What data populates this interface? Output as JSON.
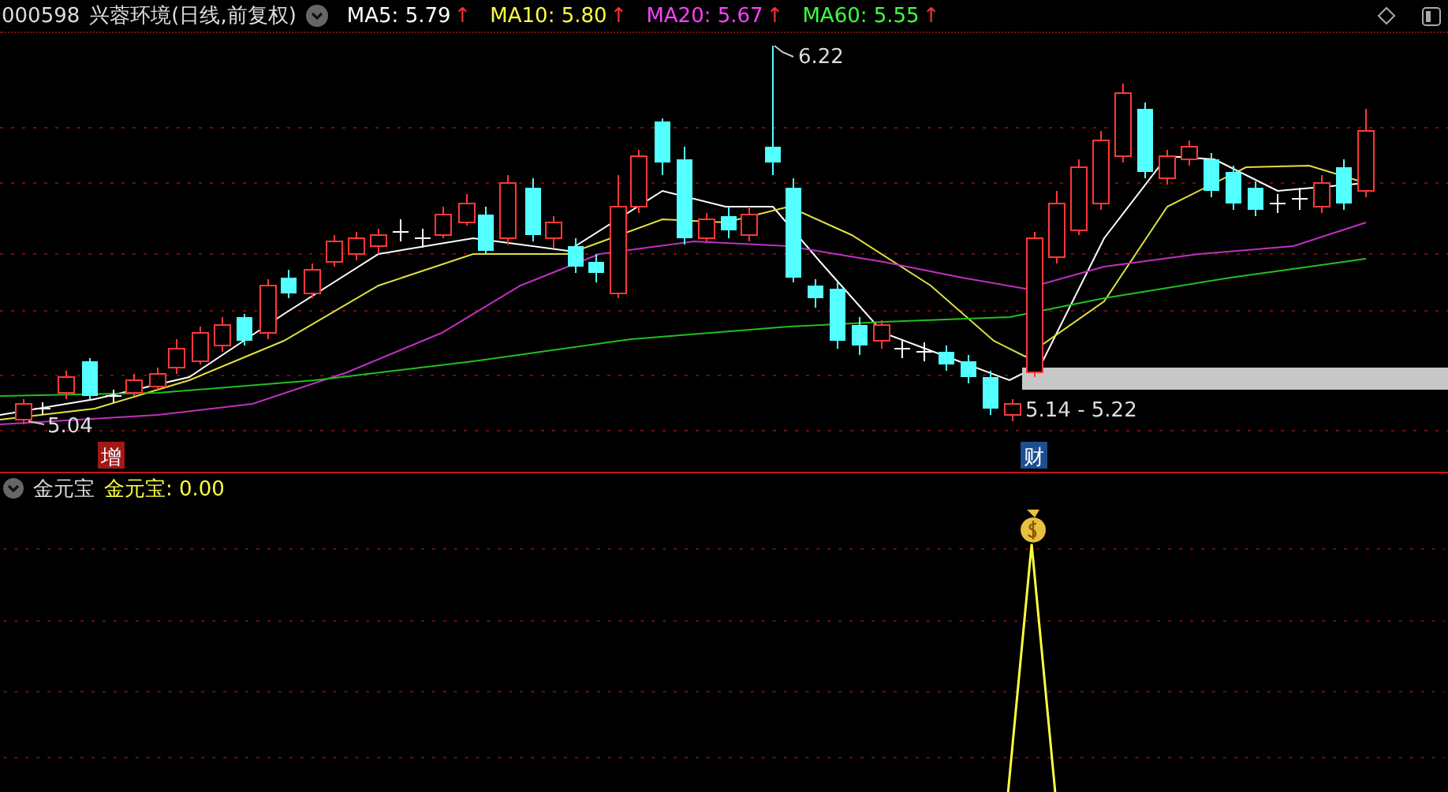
{
  "header": {
    "code": "000598",
    "name": "兴蓉环境",
    "period": "(日线,前复权)",
    "moving_averages": [
      {
        "label": "MA5: 5.79",
        "trend": "↑",
        "color": "#ffffff"
      },
      {
        "label": "MA10: 5.80",
        "trend": "↑",
        "color": "#ffff40"
      },
      {
        "label": "MA20: 5.67",
        "trend": "↑",
        "color": "#ff40ff"
      },
      {
        "label": "MA60: 5.55",
        "trend": "↑",
        "color": "#40ff40"
      }
    ]
  },
  "main_chart": {
    "high_label": "6.22",
    "low_label": "5.04",
    "range_label": "5.14 - 5.22",
    "signals": [
      {
        "text": "增",
        "color": "#a01818"
      },
      {
        "text": "财",
        "color": "#1c4f8f"
      }
    ]
  },
  "indicator": {
    "name": "金元宝",
    "value": "金元宝: 0.00"
  }
}
